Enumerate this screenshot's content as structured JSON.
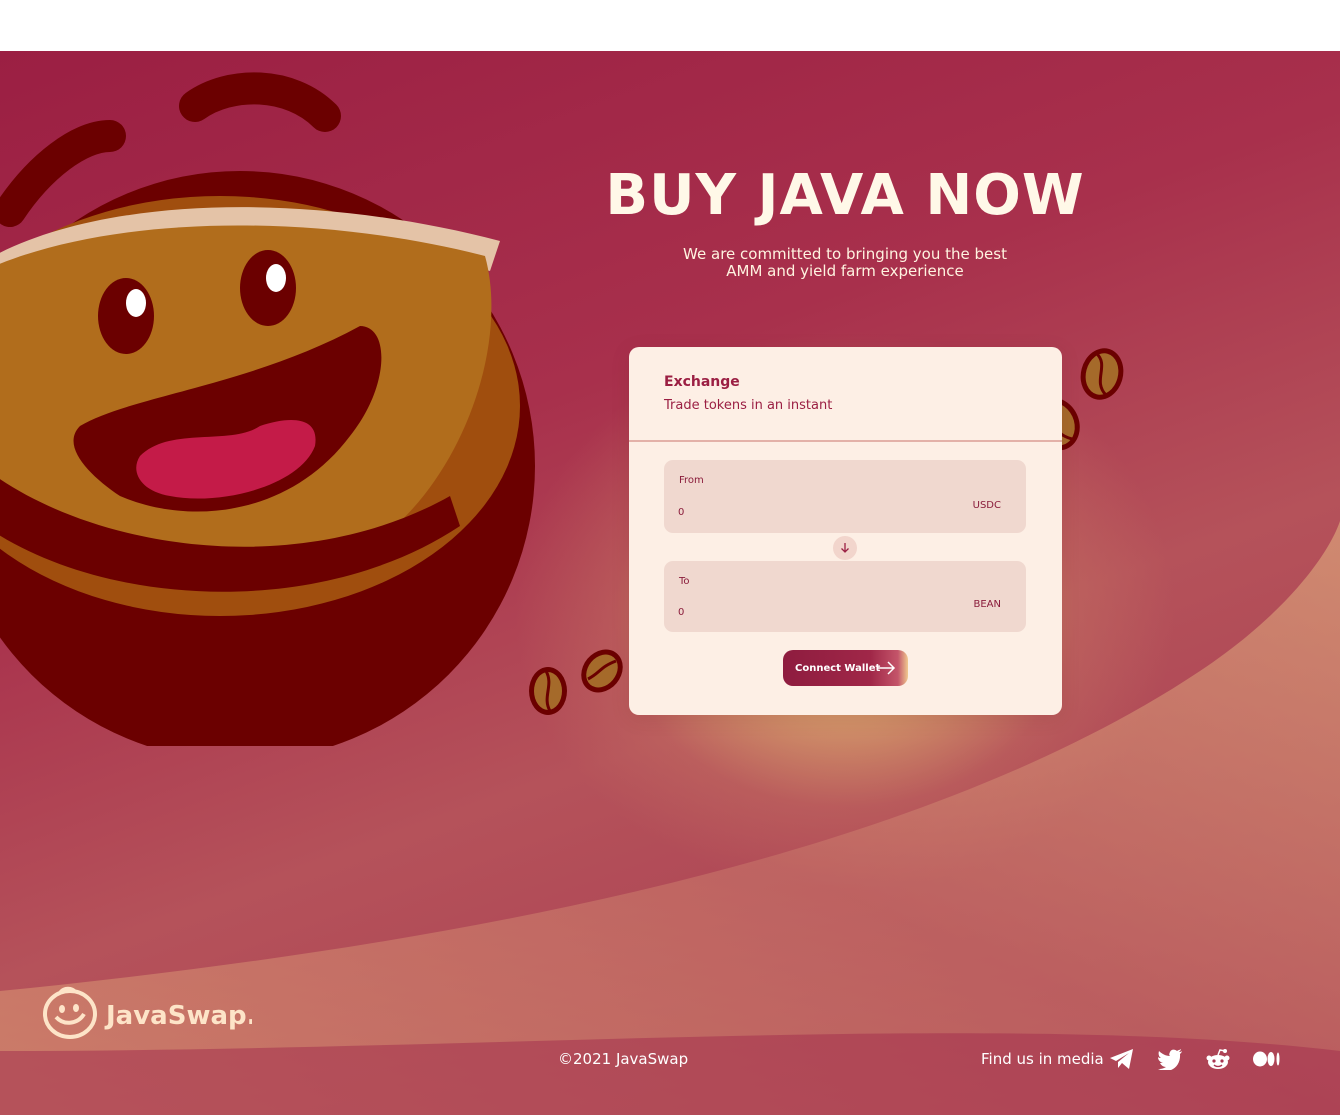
{
  "hero": {
    "title": "BUY JAVA NOW",
    "subtitle": "We are committed to bringing you the best AMM and yield farm experience"
  },
  "exchange": {
    "title": "Exchange",
    "subtitle": "Trade tokens in an instant",
    "from": {
      "label": "From",
      "value": "0",
      "token": "USDC"
    },
    "to": {
      "label": "To",
      "value": "0",
      "token": "BEAN"
    },
    "swap_icon": "arrow-down-icon",
    "connect_label": "Connect Wallet"
  },
  "footer": {
    "brand": "JavaSwap.",
    "copyright": "©2021 JavaSwap",
    "media_label": "Find us in media",
    "social": [
      "telegram-icon",
      "twitter-icon",
      "reddit-icon",
      "medium-icon"
    ]
  },
  "colors": {
    "brand": "#9b1f43",
    "accent": "#e8c07a",
    "card_bg": "#fdefe5",
    "cream": "#fff8e8"
  }
}
